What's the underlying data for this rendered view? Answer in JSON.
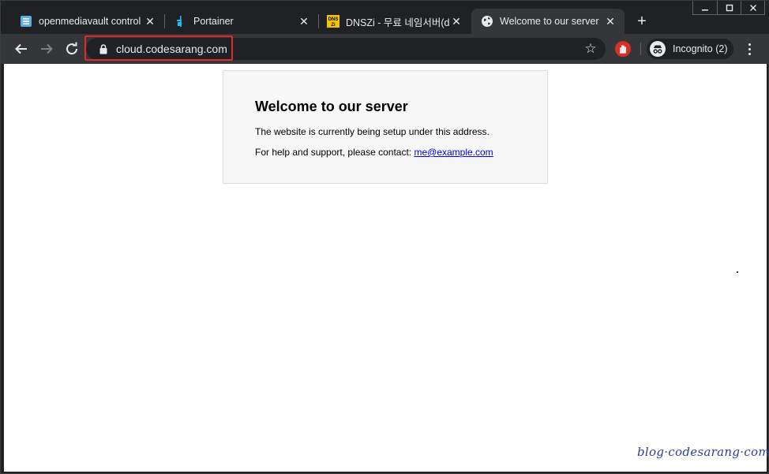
{
  "tabs": [
    {
      "title": "openmediavault control",
      "icon": "openmediavault-icon"
    },
    {
      "title": "Portainer",
      "icon": "portainer-icon"
    },
    {
      "title": "DNSZi - 무료 네임서버(d",
      "icon": "dnszi-icon"
    },
    {
      "title": "Welcome to our server",
      "icon": "globe-icon",
      "active": true
    }
  ],
  "dnszi_icon_text": {
    "top": "DNS",
    "bottom": "Zi"
  },
  "toolbar": {
    "url": "cloud.codesarang.com",
    "incognito_label": "Incognito (2)"
  },
  "page": {
    "heading": "Welcome to our server",
    "line1": "The website is currently being setup under this address.",
    "line2_prefix": "For help and support, please contact: ",
    "contact_email": "me@example.com"
  },
  "watermark": "blog·codesarang·com",
  "colors": {
    "tabstrip": "#202124",
    "active_tab": "#35363a",
    "highlight": "#e02a2a",
    "link": "#0000ee",
    "watermark": "#2b3f9a"
  }
}
